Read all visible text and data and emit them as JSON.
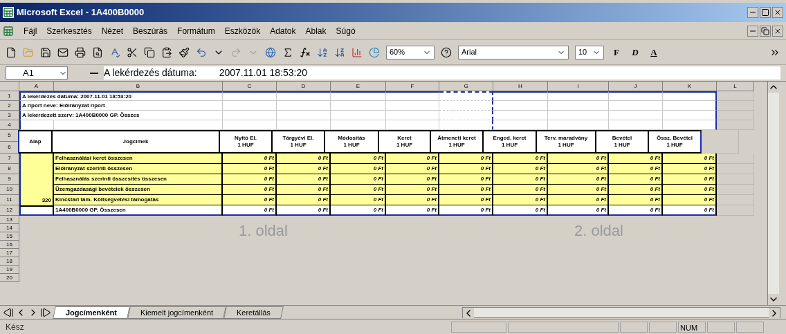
{
  "window": {
    "title": "Microsoft Excel - 1A400B0000"
  },
  "menu": [
    "Fájl",
    "Szerkesztés",
    "Nézet",
    "Beszúrás",
    "Formátum",
    "Eszközök",
    "Adatok",
    "Ablak",
    "Súgó"
  ],
  "toolbar": {
    "zoom": "60%",
    "font": "Arial",
    "font_size": "10",
    "format_buttons": [
      "F",
      "D",
      "A"
    ]
  },
  "formula_bar": {
    "cell": "A1",
    "label": "A lekérdezés dátuma:",
    "value": "2007.11.01 18:53:20"
  },
  "columns": [
    "A",
    "B",
    "C",
    "D",
    "E",
    "F",
    "G",
    "H",
    "I",
    "J",
    "K",
    "L"
  ],
  "row_numbers": [
    "1",
    "2",
    "3",
    "4",
    "5",
    "6",
    "7",
    "8",
    "9",
    "10",
    "11",
    "12",
    "13",
    "14",
    "15",
    "16",
    "17",
    "18",
    "19",
    "20"
  ],
  "info_rows": [
    "A lekérdezés dátuma:   2007.11.01 18:53:20",
    "A riport neve: Előirányzat riport",
    "A lekérdezett szerv: 1A400B0000 GP. Összes"
  ],
  "table": {
    "headers": [
      {
        "label": "Alap"
      },
      {
        "label": "Jogcímek"
      },
      {
        "label": "Nyitó EI.",
        "unit": "1 HUF"
      },
      {
        "label": "Tárgyévi EI.",
        "unit": "1 HUF"
      },
      {
        "label": "Módosítás",
        "unit": "1 HUF"
      },
      {
        "label": "Keret",
        "unit": "1 HUF"
      },
      {
        "label": "Átmeneti keret",
        "unit": "1 HUF"
      },
      {
        "label": "Enged. keret",
        "unit": "1 HUF"
      },
      {
        "label": "Terv. maradvány",
        "unit": "1 HUF"
      },
      {
        "label": "Bevétel",
        "unit": "1 HUF"
      },
      {
        "label": "Össz. Bevétel",
        "unit": "1 HUF"
      }
    ],
    "rows": [
      {
        "group": "",
        "label": "Felhasználási keret összesen",
        "highlighted": true,
        "values": [
          "0 Ft",
          "0 Ft",
          "0 Ft",
          "0 Ft",
          "0 Ft",
          "0 Ft",
          "0 Ft",
          "0 Ft",
          "0 Ft"
        ]
      },
      {
        "group": "",
        "label": "Előirányzat szerinti összesen",
        "highlighted": true,
        "values": [
          "0 Ft",
          "0 Ft",
          "0 Ft",
          "0 Ft",
          "0 Ft",
          "0 Ft",
          "0 Ft",
          "0 Ft",
          "0 Ft"
        ]
      },
      {
        "group": "",
        "label": "Felhasználás szerinti összesítés összesen",
        "highlighted": true,
        "values": [
          "0 Ft",
          "0 Ft",
          "0 Ft",
          "0 Ft",
          "0 Ft",
          "0 Ft",
          "0 Ft",
          "0 Ft",
          "0 Ft"
        ]
      },
      {
        "group": "",
        "label": "Üzemgazdasági bevételek összesen",
        "highlighted": true,
        "values": [
          "0 Ft",
          "0 Ft",
          "0 Ft",
          "0 Ft",
          "0 Ft",
          "0 Ft",
          "0 Ft",
          "0 Ft",
          "0 Ft"
        ]
      },
      {
        "group": "320",
        "label": "Kincstári tám. Költségvetési támogatás",
        "highlighted": true,
        "values": [
          "0 Ft",
          "0 Ft",
          "0 Ft",
          "0 Ft",
          "0 Ft",
          "0 Ft",
          "0 Ft",
          "0 Ft",
          "0 Ft"
        ]
      },
      {
        "group": "",
        "label": "1A400B0000 GP. Összesen",
        "highlighted": false,
        "values": [
          "0 Ft",
          "0 Ft",
          "0 Ft",
          "0 Ft",
          "0 Ft",
          "0 Ft",
          "0 Ft",
          "0 Ft",
          "0 Ft"
        ]
      }
    ]
  },
  "page_labels": [
    "1. oldal",
    "2. oldal"
  ],
  "sheet_tabs": [
    {
      "label": "Jogcímenként",
      "selected": true
    },
    {
      "label": "Kiemelt jogcímenként",
      "selected": false
    },
    {
      "label": "Keretállás",
      "selected": false
    }
  ],
  "status_bar": {
    "text": "Kész",
    "indicators": [
      "NUM"
    ]
  }
}
